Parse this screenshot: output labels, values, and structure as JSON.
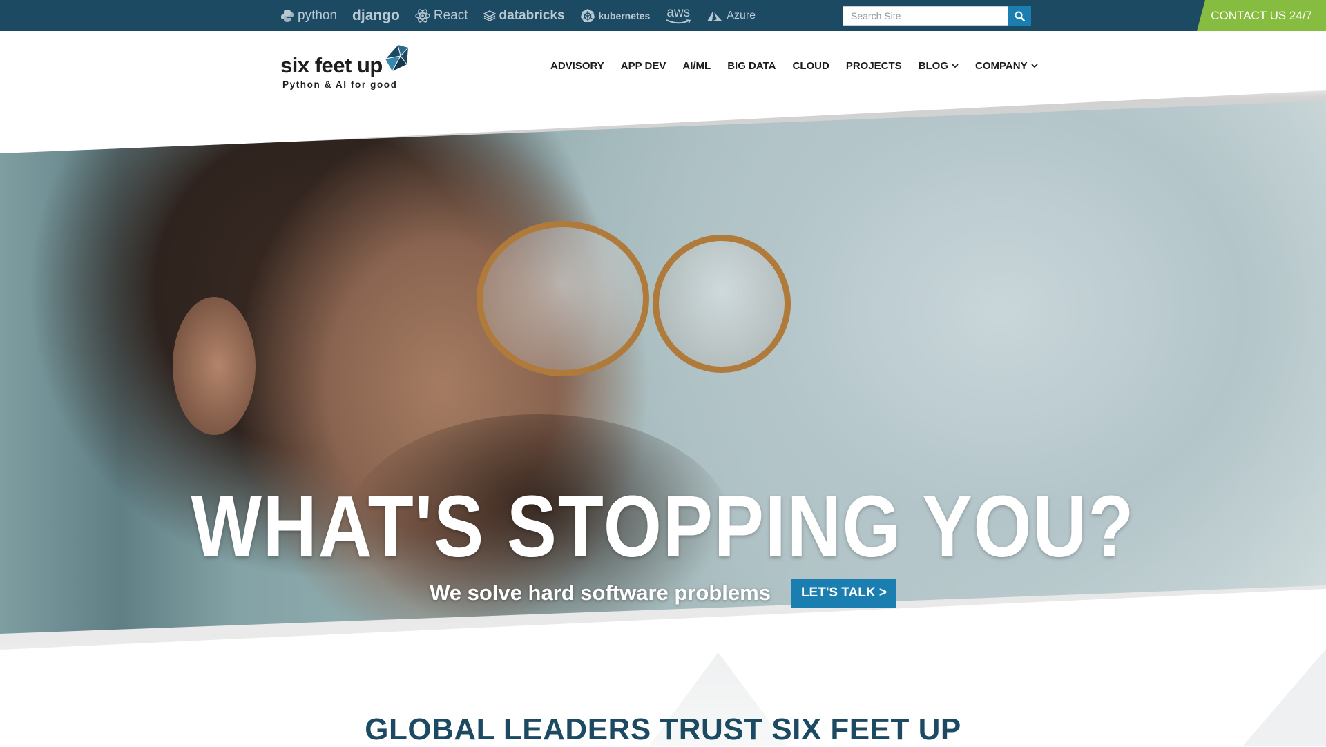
{
  "topbar": {
    "tech_logos": [
      {
        "icon": "python-icon",
        "label": "python"
      },
      {
        "icon": "",
        "label": "django"
      },
      {
        "icon": "react-icon",
        "label": "React"
      },
      {
        "icon": "databricks-icon",
        "label": "databricks"
      },
      {
        "icon": "kubernetes-icon",
        "label": "kubernetes"
      },
      {
        "icon": "aws-smile-icon",
        "label": "aws"
      },
      {
        "icon": "azure-icon",
        "label": "Azure"
      }
    ],
    "search": {
      "placeholder": "Search Site",
      "value": ""
    },
    "contact_label": "CONTACT US 24/7",
    "colors": {
      "bar": "#1c4a63",
      "contact": "#86bc3f",
      "accent": "#1a7fb0"
    }
  },
  "header": {
    "brand_name": "six feet up",
    "brand_tagline": "Python & AI for good",
    "nav": [
      {
        "label": "ADVISORY",
        "dropdown": false
      },
      {
        "label": "APP DEV",
        "dropdown": false
      },
      {
        "label": "AI/ML",
        "dropdown": false
      },
      {
        "label": "BIG DATA",
        "dropdown": false
      },
      {
        "label": "CLOUD",
        "dropdown": false
      },
      {
        "label": "PROJECTS",
        "dropdown": false
      },
      {
        "label": "BLOG",
        "dropdown": true
      },
      {
        "label": "COMPANY",
        "dropdown": true
      }
    ]
  },
  "hero": {
    "title": "WHAT'S STOPPING YOU?",
    "subtitle": "We solve hard software problems",
    "cta_label": "LET'S TALK >"
  },
  "trust": {
    "heading": "GLOBAL LEADERS TRUST SIX FEET UP"
  }
}
